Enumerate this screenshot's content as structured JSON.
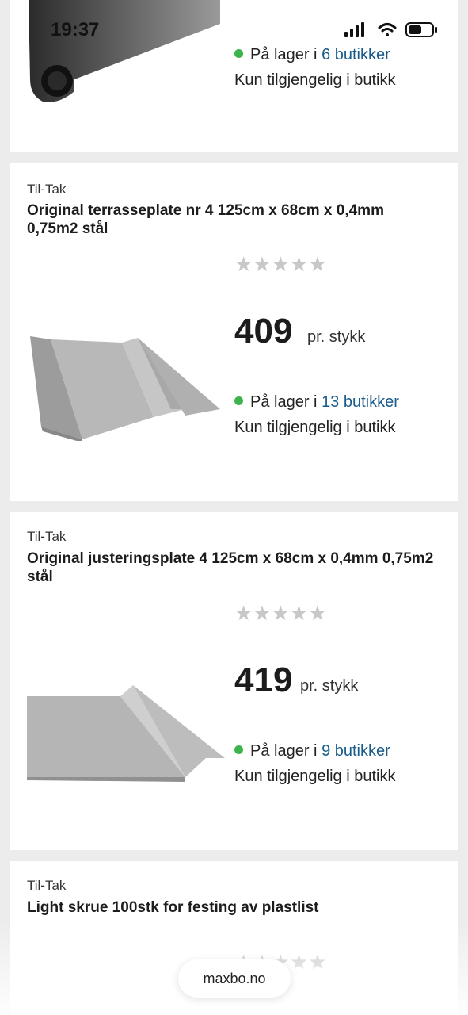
{
  "status_bar": {
    "time": "19:37"
  },
  "products": [
    {
      "stock_prefix": "På lager i ",
      "stock_link": "6 butikker",
      "availability": "Kun tilgjengelig i butikk"
    },
    {
      "brand": "Til-Tak",
      "title": "Original terrasseplate nr 4 125cm x 68cm x 0,4mm 0,75m2 stål",
      "rating": "★★★★★",
      "price": "409",
      "unit": "pr. stykk",
      "stock_prefix": "På lager i ",
      "stock_link": "13 butikker",
      "availability": "Kun tilgjengelig i butikk"
    },
    {
      "brand": "Til-Tak",
      "title": "Original justeringsplate 4 125cm x 68cm x 0,4mm 0,75m2 stål",
      "rating": "★★★★★",
      "price": "419",
      "unit": "pr. stykk",
      "stock_prefix": "På lager i ",
      "stock_link": "9 butikker",
      "availability": "Kun tilgjengelig i butikk"
    },
    {
      "brand": "Til-Tak",
      "title": "Light skrue 100stk for festing av plastlist",
      "rating": "★★★★★"
    }
  ],
  "browser": {
    "url": "maxbo.no"
  },
  "colors": {
    "in_stock": "#3cb44b",
    "link": "#1a5c8a",
    "rating_empty": "#c8c8c8"
  }
}
